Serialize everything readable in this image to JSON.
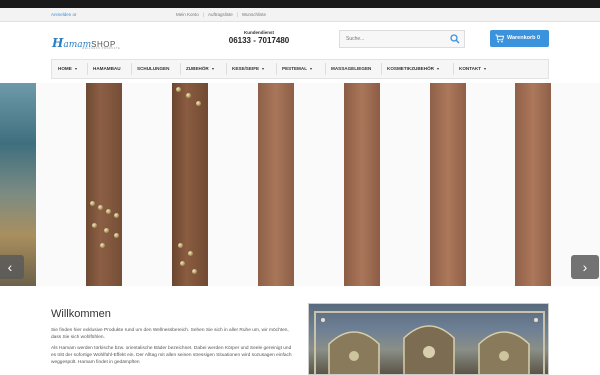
{
  "util": {
    "login_link": "Anmelden",
    "login_suffix": "or",
    "links": [
      "Mein Konto",
      "Auftragsliste",
      "Wunschliste"
    ]
  },
  "header": {
    "logo": {
      "h": "H",
      "amam": "amam",
      "shop": "SHOP",
      "tagline": "WELLNESS PRODUKTE"
    },
    "service_label": "Kundendienst",
    "service_phone": "06133 - 7017480",
    "search_placeholder": "Suche...",
    "cart_label": "Warenkorb 0"
  },
  "nav": {
    "items": [
      {
        "label": "HOME",
        "dropdown": true
      },
      {
        "label": "HAMAMBAU",
        "dropdown": false
      },
      {
        "label": "SCHULUNGEN",
        "dropdown": false
      },
      {
        "label": "ZUBEHÖR",
        "dropdown": true
      },
      {
        "label": "KESE/SEIFE",
        "dropdown": true
      },
      {
        "label": "PESTEMAL",
        "dropdown": true
      },
      {
        "label": "MASSAGELIEGEN",
        "dropdown": false
      },
      {
        "label": "KOSMETIKZUBEHÖR",
        "dropdown": true
      },
      {
        "label": "KONTAKT",
        "dropdown": true
      }
    ]
  },
  "slider": {
    "prev_icon": "chevron-left-icon",
    "next_icon": "chevron-right-icon",
    "prev_glyph": "‹",
    "next_glyph": "›"
  },
  "content": {
    "title": "Willkommen",
    "para1": "Sie finden hier exklusive Produkte rund um den Wellnessbereich. Sehen Sie sich in aller Ruhe um, wir möchten, dass Sie sich wohlfühlen.",
    "para2": "Als Hamam werden türkische bzw. orientalische Bäder bezeichnet. Dabei werden Körper und Seele gereinigt und es tritt der sofortige Wohlfühl-Effekt ein. Der Alltag mit allen seinen stressigen Situationen wird sozusagen einfach weggespült. Hamam findet in gedämpften"
  },
  "colors": {
    "accent": "#3a93dc",
    "topbar": "#1a1a1a"
  }
}
